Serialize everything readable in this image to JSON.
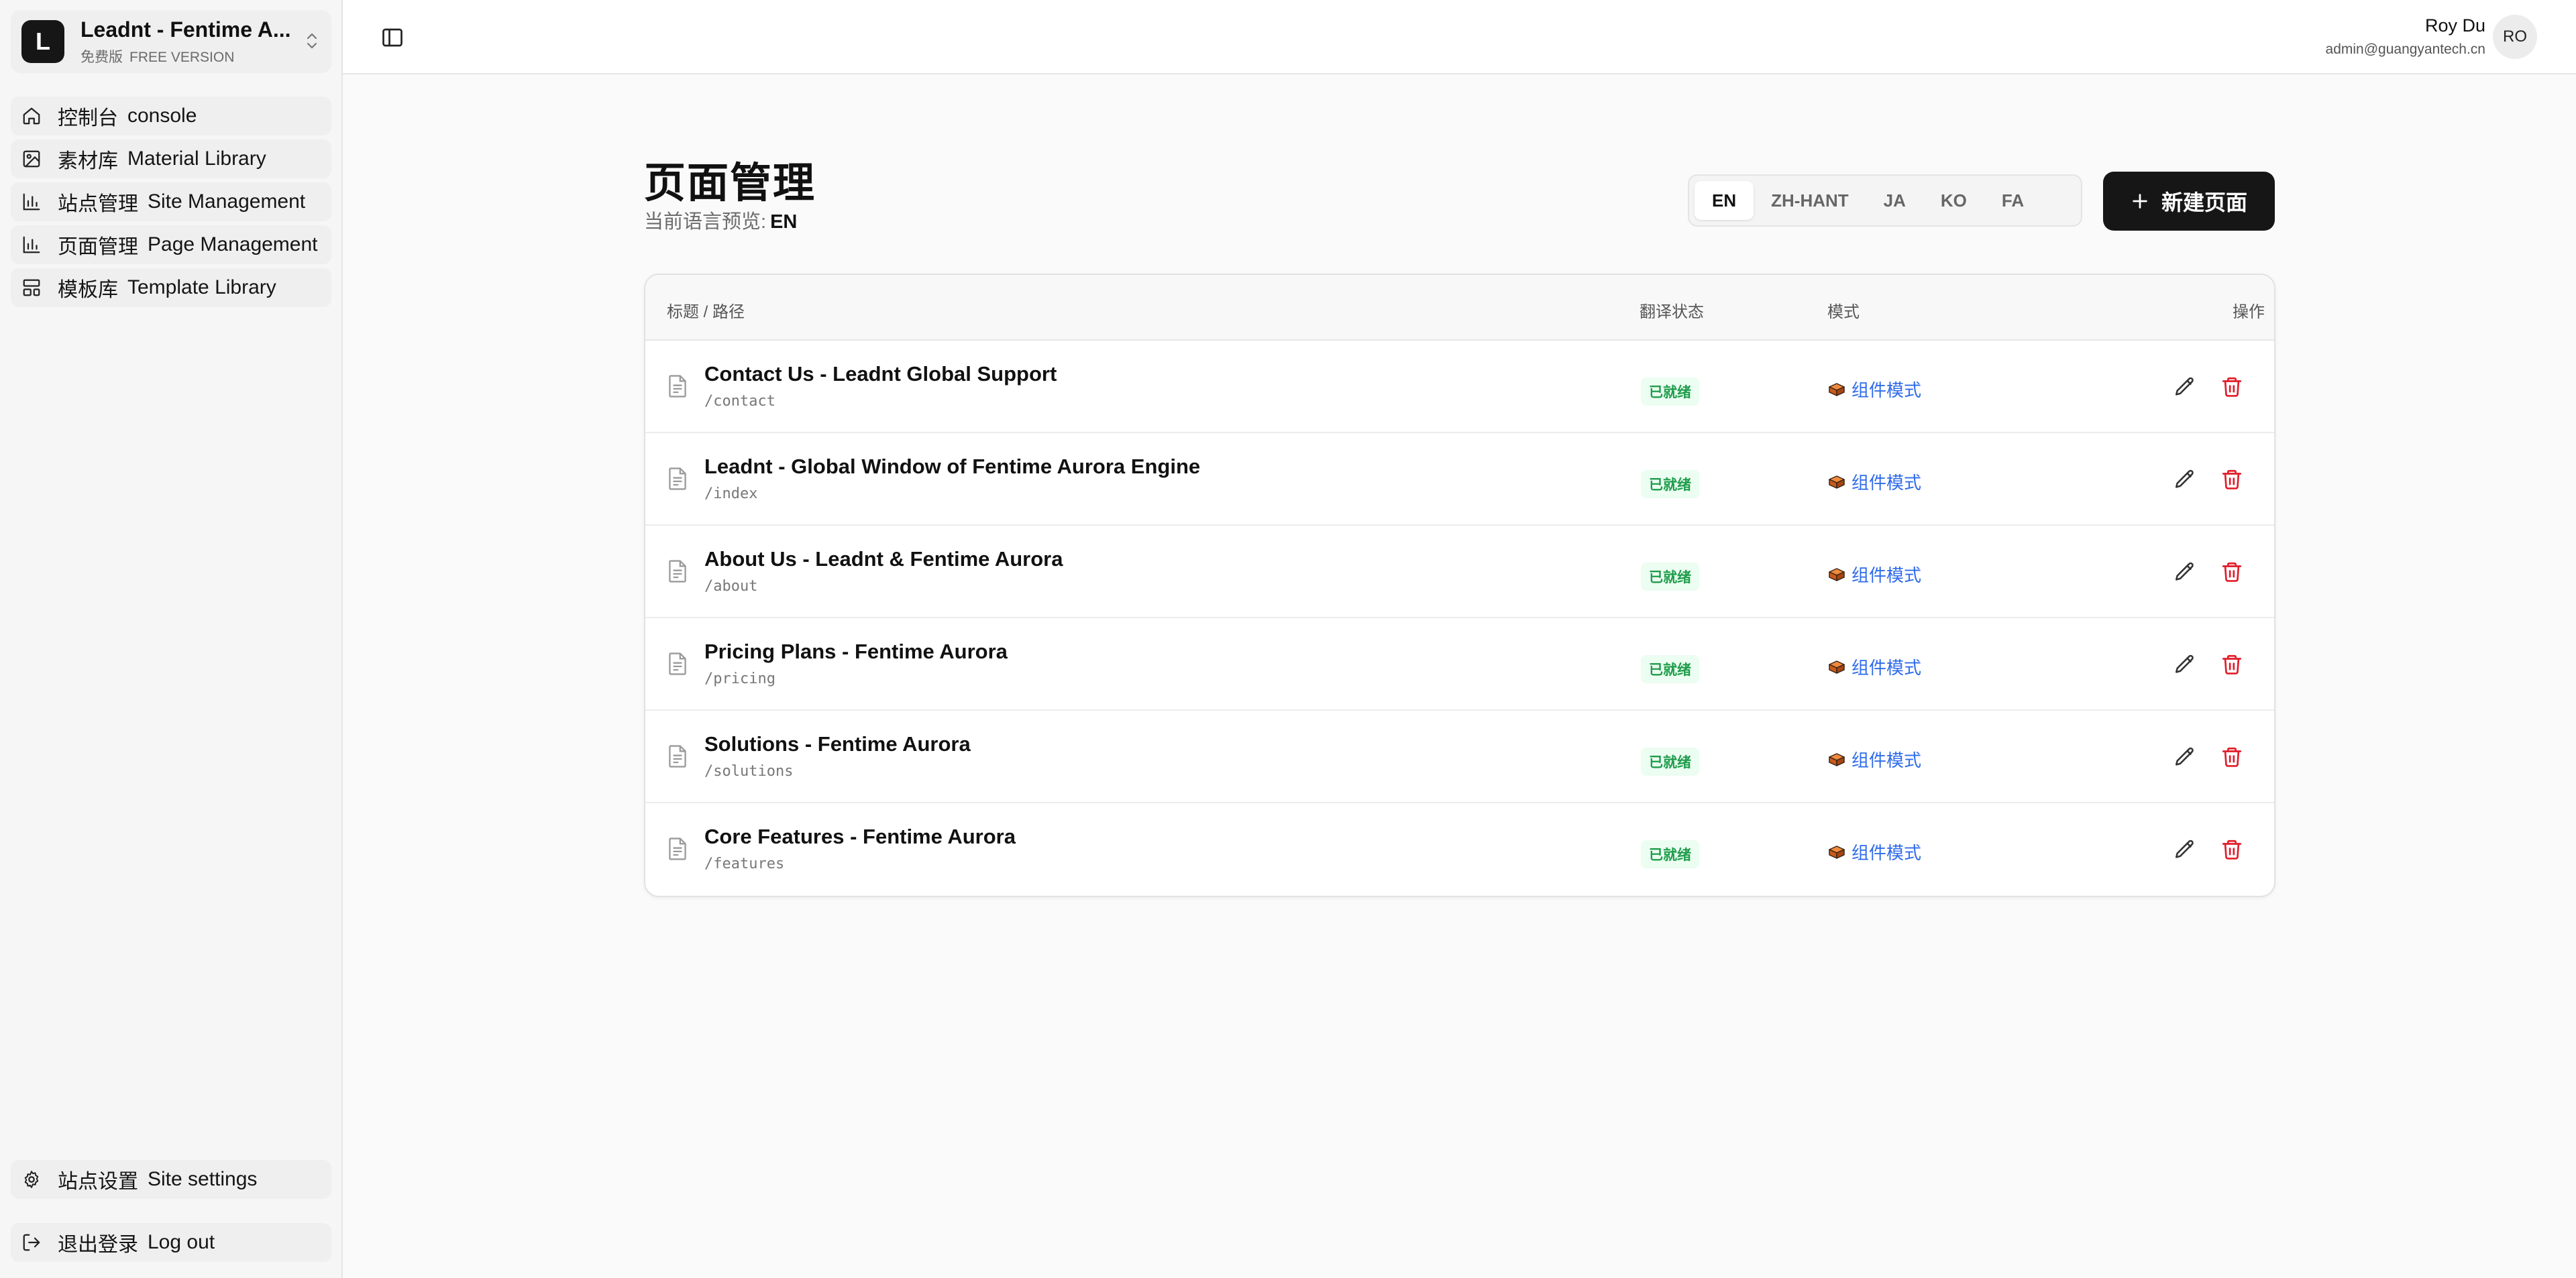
{
  "sidebar": {
    "team": {
      "initial": "L",
      "name": "Leadnt - Fentime A...",
      "plan_zh": "免费版",
      "plan_en": "FREE VERSION"
    },
    "nav": [
      {
        "zh": "控制台",
        "en": "console",
        "icon": "home-icon"
      },
      {
        "zh": "素材库",
        "en": "Material Library",
        "icon": "image-library-icon"
      },
      {
        "zh": "站点管理",
        "en": "Site Management",
        "icon": "bar-chart-icon"
      },
      {
        "zh": "页面管理",
        "en": "Page Management",
        "icon": "bar-chart-icon"
      },
      {
        "zh": "模板库",
        "en": "Template Library",
        "icon": "layout-template-icon"
      }
    ],
    "bottom": [
      {
        "zh": "站点设置",
        "en": "Site settings",
        "icon": "gear-icon"
      },
      {
        "zh": "退出登录",
        "en": "Log out",
        "icon": "logout-icon"
      }
    ]
  },
  "header": {
    "user_name": "Roy Du",
    "user_email": "admin@guangyantech.cn",
    "avatar_initials": "RO"
  },
  "main": {
    "title": "页面管理",
    "lang_preview_label": "当前语言预览:",
    "lang_preview_value": "EN",
    "languages": [
      "EN",
      "ZH-HANT",
      "JA",
      "KO",
      "FA"
    ],
    "active_language": "EN",
    "new_page_label": "新建页面"
  },
  "table": {
    "columns": {
      "title": "标题 / 路径",
      "status": "翻译状态",
      "mode": "模式",
      "actions": "操作"
    },
    "rows": [
      {
        "title": "Contact Us - Leadnt Global Support",
        "path": "/contact",
        "status": "已就绪",
        "mode": "组件模式"
      },
      {
        "title": "Leadnt - Global Window of Fentime Aurora Engine",
        "path": "/index",
        "status": "已就绪",
        "mode": "组件模式"
      },
      {
        "title": "About Us - Leadnt & Fentime Aurora",
        "path": "/about",
        "status": "已就绪",
        "mode": "组件模式"
      },
      {
        "title": "Pricing Plans - Fentime Aurora",
        "path": "/pricing",
        "status": "已就绪",
        "mode": "组件模式"
      },
      {
        "title": "Solutions - Fentime Aurora",
        "path": "/solutions",
        "status": "已就绪",
        "mode": "组件模式"
      },
      {
        "title": "Core Features - Fentime Aurora",
        "path": "/features",
        "status": "已就绪",
        "mode": "组件模式"
      }
    ]
  },
  "colors": {
    "accent": "#161616",
    "status_ready": "#1f9d4c",
    "link": "#2f6bea",
    "danger": "#e11d2a"
  }
}
